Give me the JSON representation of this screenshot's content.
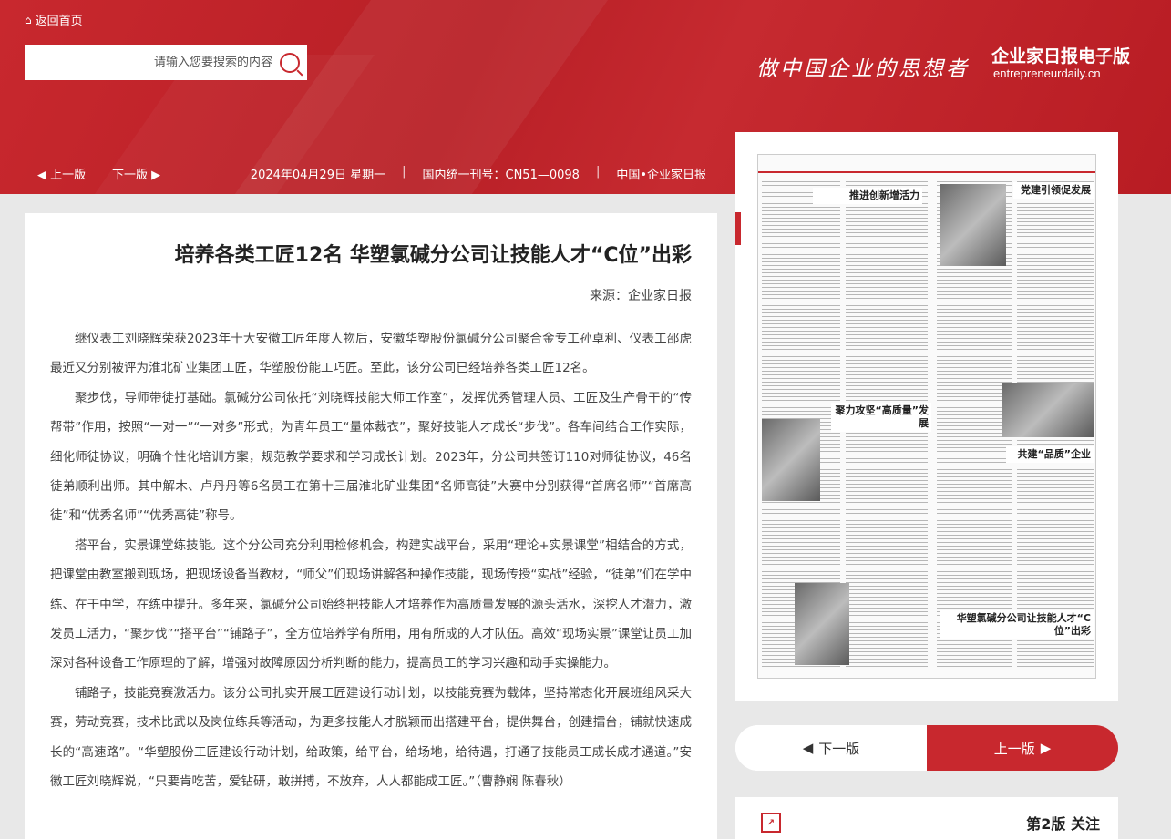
{
  "header": {
    "home_label": "返回首页",
    "search_placeholder": "请输入您要搜索的内容",
    "slogan": "做中国企业的思想者",
    "brand_title": "企业家日报电子版",
    "brand_sub": "entrepreneurdaily.cn"
  },
  "infobar": {
    "prev_label": "上一版",
    "next_label": "下一版",
    "date": "2024年04月29日 星期一",
    "issue_code": "国内统一刊号：CN51—0098",
    "paper_name": "中国•企业家日报"
  },
  "article": {
    "title": "培养各类工匠12名 华塑氯碱分公司让技能人才“C位”出彩",
    "source": "来源：企业家日报",
    "paragraphs": [
      "继仪表工刘晓辉荣获2023年十大安徽工匠年度人物后，安徽华塑股份氯碱分公司聚合金专工孙卓利、仪表工邵虎最近又分别被评为淮北矿业集团工匠，华塑股份能工巧匠。至此，该分公司已经培养各类工匠12名。",
      "聚步伐，导师带徒打基础。氯碱分公司依托“刘晓辉技能大师工作室”，发挥优秀管理人员、工匠及生产骨干的“传帮带”作用，按照“一对一”“一对多”形式，为青年员工“量体裁衣”，聚好技能人才成长“步伐”。各车间结合工作实际，细化师徒协议，明确个性化培训方案，规范教学要求和学习成长计划。2023年，分公司共签订110对师徒协议，46名徒弟顺利出师。其中解木、卢丹丹等6名员工在第十三届淮北矿业集团“名师高徒”大赛中分别获得“首席名师”“首席高徒”和“优秀名师”“优秀高徒”称号。",
      "搭平台，实景课堂练技能。这个分公司充分利用检修机会，构建实战平台，采用“理论+实景课堂”相结合的方式，把课堂由教室搬到现场，把现场设备当教材，“师父”们现场讲解各种操作技能，现场传授“实战”经验，“徒弟”们在学中练、在干中学，在练中提升。多年来，氯碱分公司始终把技能人才培养作为高质量发展的源头活水，深挖人才潜力，激发员工活力，“聚步伐”“搭平台”“铺路子”，全方位培养学有所用，用有所成的人才队伍。高效“现场实景”课堂让员工加深对各种设备工作原理的了解，增强对故障原因分析判断的能力，提高员工的学习兴趣和动手实操能力。",
      "铺路子，技能竞赛激活力。该分公司扎实开展工匠建设行动计划，以技能竞赛为载体，坚持常态化开展班组风采大赛，劳动竞赛，技术比武以及岗位练兵等活动，为更多技能人才脱颖而出搭建平台，提供舞台，创建擂台，铺就快速成长的“高速路”。“华塑股份工匠建设行动计划，给政策，给平台，给场地，给待遇，打通了技能员工成长成才通道。”安徽工匠刘晓辉说，“只要肯吃苦，爱钻研，敢拼搏，不放弃，人人都能成工匠。”（曹静娴 陈春秋）"
    ]
  },
  "newspaper": {
    "headlines": [
      "党建引领促发展",
      "推进创新增活力",
      "共建“品质”企业",
      "聚力攻坚“高质量”发展",
      "华塑氯碱分公司让技能人才“C位”出彩"
    ]
  },
  "page_nav": {
    "prev_label": "上一版",
    "next_label": "下一版"
  },
  "page_list": [
    {
      "label": "第2版 关注"
    }
  ],
  "colors": {
    "brand_red": "#c8282e",
    "page_bg": "#e8e8e8"
  }
}
